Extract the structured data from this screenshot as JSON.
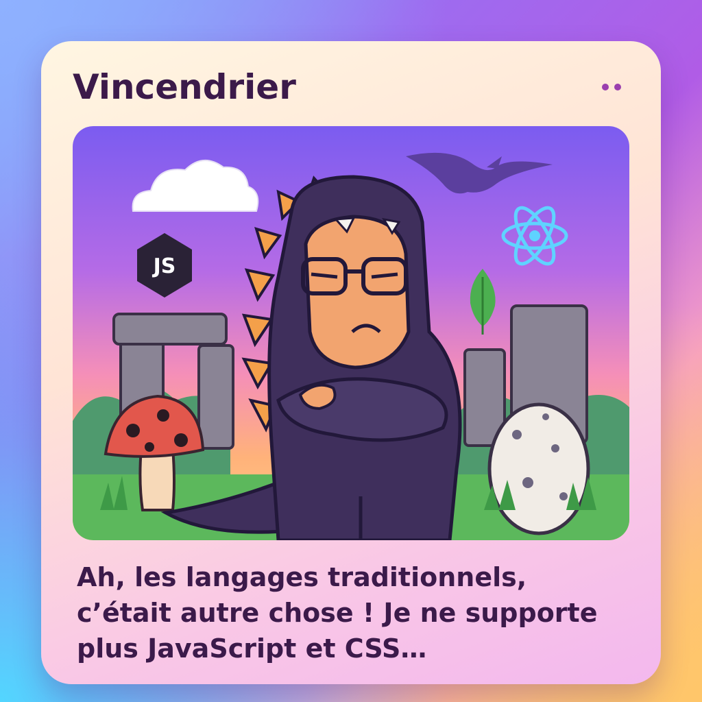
{
  "card": {
    "title": "Vincendrier",
    "caption": "Ah, les langages traditionnels, c’était autre chose ! Je ne supporte plus JavaScript et CSS…"
  },
  "scene": {
    "js_badge_text": "JS",
    "icons": [
      "js-logo-icon",
      "react-logo-icon",
      "mongodb-leaf-icon",
      "pterodactyl-icon",
      "cloud-icon",
      "mushroom-icon",
      "dinosaur-egg-icon",
      "stonehenge-icon"
    ]
  },
  "colors": {
    "title_text": "#3b1a4a",
    "menu_dots": "#9b3fae",
    "sky_top": "#7b5cf0",
    "sky_bottom": "#ffb27a",
    "costume": "#3f2f5c",
    "spikes": "#f4a04a",
    "skin": "#f2a46f",
    "grass": "#5cb85c",
    "react_blue": "#5fd3ff",
    "leaf_green": "#4caf50"
  }
}
